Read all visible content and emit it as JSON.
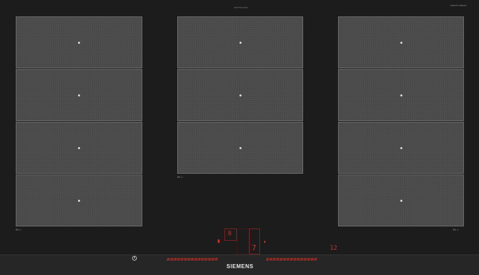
{
  "top_label": "EX975LVV1E",
  "schott_label": "SCHOTT CERAN",
  "brand": "SIEMENS",
  "display": {
    "digit_main": "7",
    "timer": "12",
    "center_code": "8"
  },
  "zones": {
    "left_count": 4,
    "middle_count": 3,
    "right_count": 4
  },
  "colors": {
    "surface": "#1c1c1c",
    "zone": "#4a4a4a",
    "indicator_red": "#c0352f"
  },
  "icons": [
    "power-icon",
    "slider-control"
  ]
}
